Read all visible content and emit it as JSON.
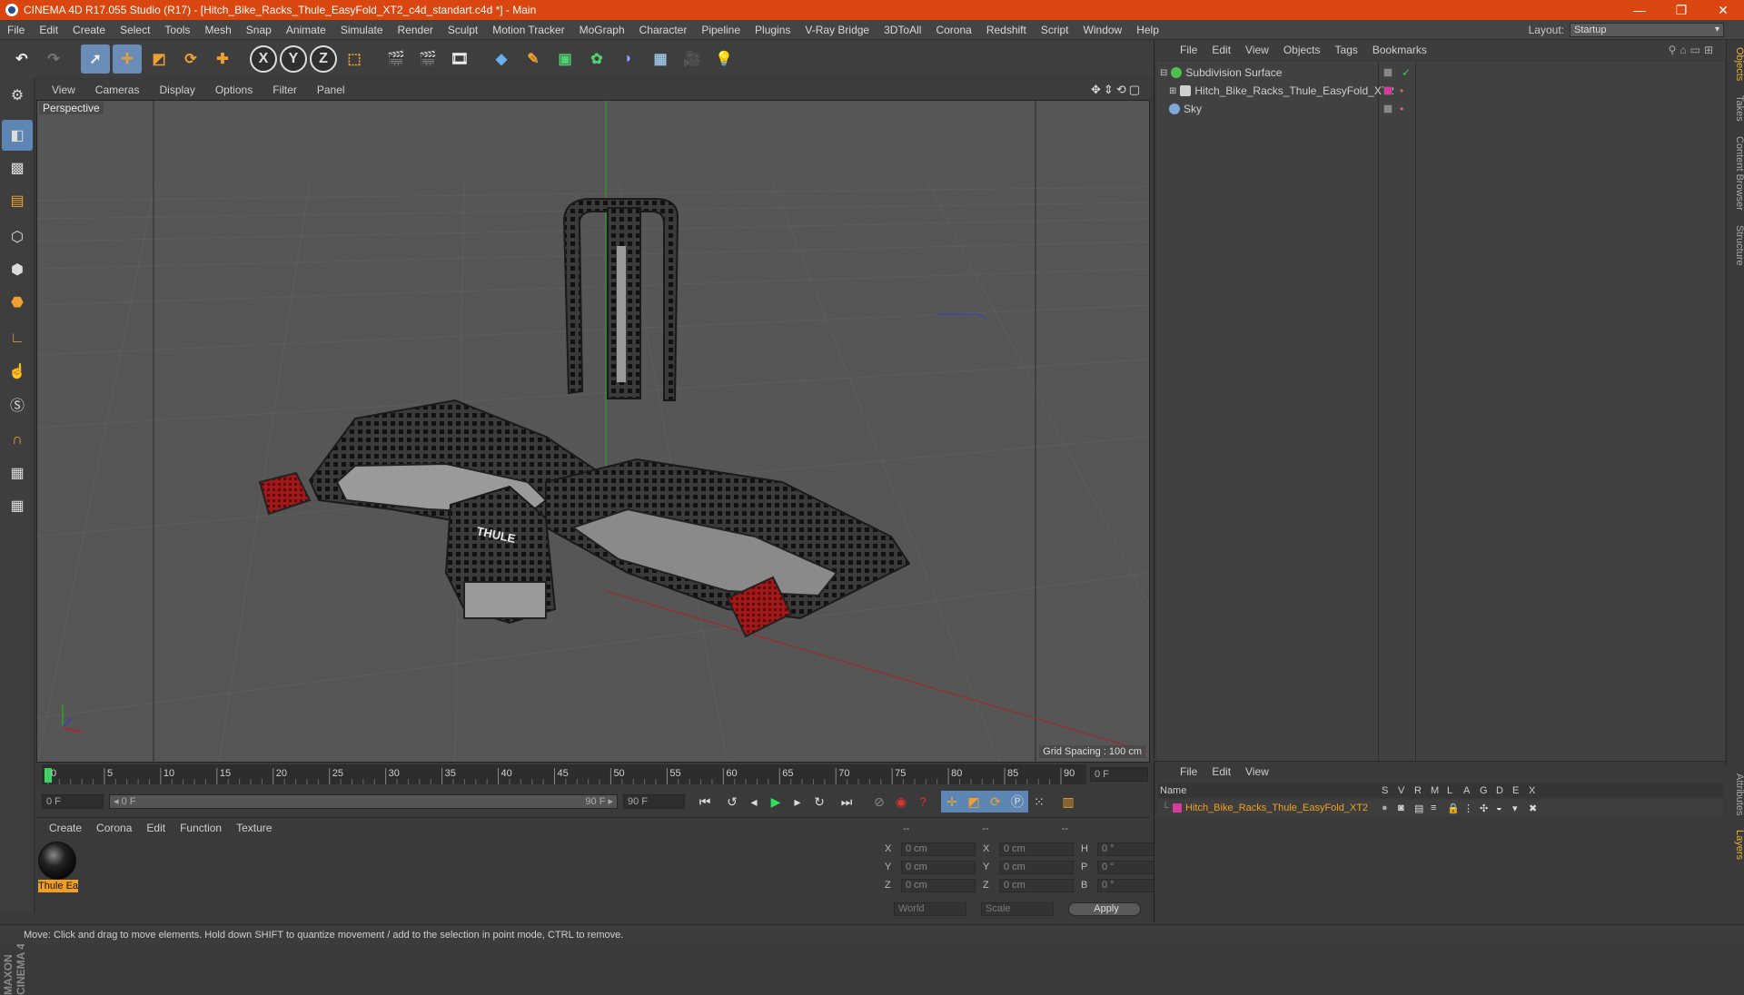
{
  "titlebar": {
    "title": "CINEMA 4D R17.055 Studio (R17) - [Hitch_Bike_Racks_Thule_EasyFold_XT2_c4d_standart.c4d *] - Main",
    "minimize": "—",
    "restore": "❐",
    "close": "✕"
  },
  "menubar": {
    "items": [
      "File",
      "Edit",
      "Create",
      "Select",
      "Tools",
      "Mesh",
      "Snap",
      "Animate",
      "Simulate",
      "Render",
      "Sculpt",
      "Motion Tracker",
      "MoGraph",
      "Character",
      "Pipeline",
      "Plugins",
      "V-Ray Bridge",
      "3DToAll",
      "Corona",
      "Redshift",
      "Script",
      "Window",
      "Help"
    ],
    "layout_label": "Layout:",
    "layout_value": "Startup"
  },
  "toolbar": {
    "axis_x": "X",
    "axis_y": "Y",
    "axis_z": "Z"
  },
  "viewport": {
    "menu": [
      "View",
      "Cameras",
      "Display",
      "Options",
      "Filter",
      "Panel"
    ],
    "camera_label": "Perspective",
    "grid_spacing": "Grid Spacing : 100 cm",
    "brand_text": "THULE"
  },
  "timeline": {
    "ticks": [
      "0",
      "5",
      "10",
      "15",
      "20",
      "25",
      "30",
      "35",
      "40",
      "45",
      "50",
      "55",
      "60",
      "65",
      "70",
      "75",
      "80",
      "85",
      "90"
    ],
    "current_frame": "0 F",
    "start_field": "0 F",
    "range_start": "◂ 0 F",
    "range_end": "90 F ▸",
    "end_field": "90 F"
  },
  "material_panel": {
    "menu": [
      "Create",
      "Corona",
      "Edit",
      "Function",
      "Texture"
    ],
    "material_name": "Thule Ea"
  },
  "coords": {
    "header": [
      "--",
      "--",
      "--"
    ],
    "rows": [
      {
        "a": "X",
        "av": "0 cm",
        "b": "X",
        "bv": "0 cm",
        "c": "H",
        "cv": "0 °"
      },
      {
        "a": "Y",
        "av": "0 cm",
        "b": "Y",
        "bv": "0 cm",
        "c": "P",
        "cv": "0 °"
      },
      {
        "a": "Z",
        "av": "0 cm",
        "b": "Z",
        "bv": "0 cm",
        "c": "B",
        "cv": "0 °"
      }
    ],
    "world": "World",
    "scale": "Scale",
    "apply": "Apply"
  },
  "objects": {
    "menu": [
      "File",
      "Edit",
      "View",
      "Objects",
      "Tags",
      "Bookmarks"
    ],
    "items": [
      {
        "name": "Subdivision Surface",
        "icon_color": "#4ec04e"
      },
      {
        "name": "Hitch_Bike_Racks_Thule_EasyFold_XT2",
        "icon_color": "#cfcfcf",
        "tag_color": "#d63a9a"
      },
      {
        "name": "Sky",
        "icon_color": "#7fa7d8"
      }
    ]
  },
  "side_tabs_top": [
    "Objects",
    "Takes",
    "Content Browser",
    "Structure"
  ],
  "side_tabs_bottom": [
    "Attributes",
    "Layers"
  ],
  "layers": {
    "menu": [
      "File",
      "Edit",
      "View"
    ],
    "header_name": "Name",
    "header_cols": [
      "S",
      "V",
      "R",
      "M",
      "L",
      "A",
      "G",
      "D",
      "E",
      "X"
    ],
    "row_name": "Hitch_Bike_Racks_Thule_EasyFold_XT2",
    "row_color": "#d63a9a"
  },
  "maxon_text": "MAXON CINEMA 4D",
  "statusbar": {
    "text": "Move: Click and drag to move elements. Hold down SHIFT to quantize movement / add to the selection in point mode, CTRL to remove."
  }
}
